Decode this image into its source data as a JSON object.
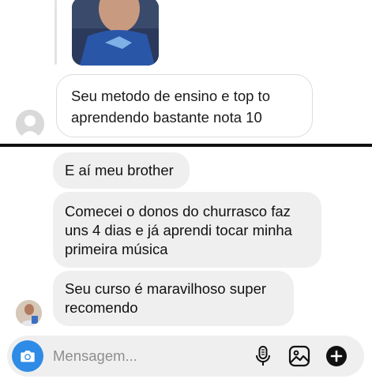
{
  "top_thread": {
    "outgoing_message_lines": [
      "Seu metodo de ensino e top to",
      "aprendendo bastante nota 10"
    ]
  },
  "chat": {
    "messages": [
      {
        "lines": [
          "E aí meu brother"
        ]
      },
      {
        "lines": [
          "Comecei o donos do churrasco faz",
          "uns 4 dias e já aprendi tocar minha",
          "primeira música"
        ]
      },
      {
        "lines": [
          "Seu curso é maravilhoso super",
          "recomendo"
        ]
      }
    ]
  },
  "composer": {
    "placeholder": "Mensagem...",
    "icons": [
      "camera-icon",
      "microphone-icon",
      "gallery-icon",
      "add-icon"
    ]
  },
  "colors": {
    "camera_button": "#2e8be6",
    "bubble_gray": "#efefef",
    "separator": "#111111"
  }
}
